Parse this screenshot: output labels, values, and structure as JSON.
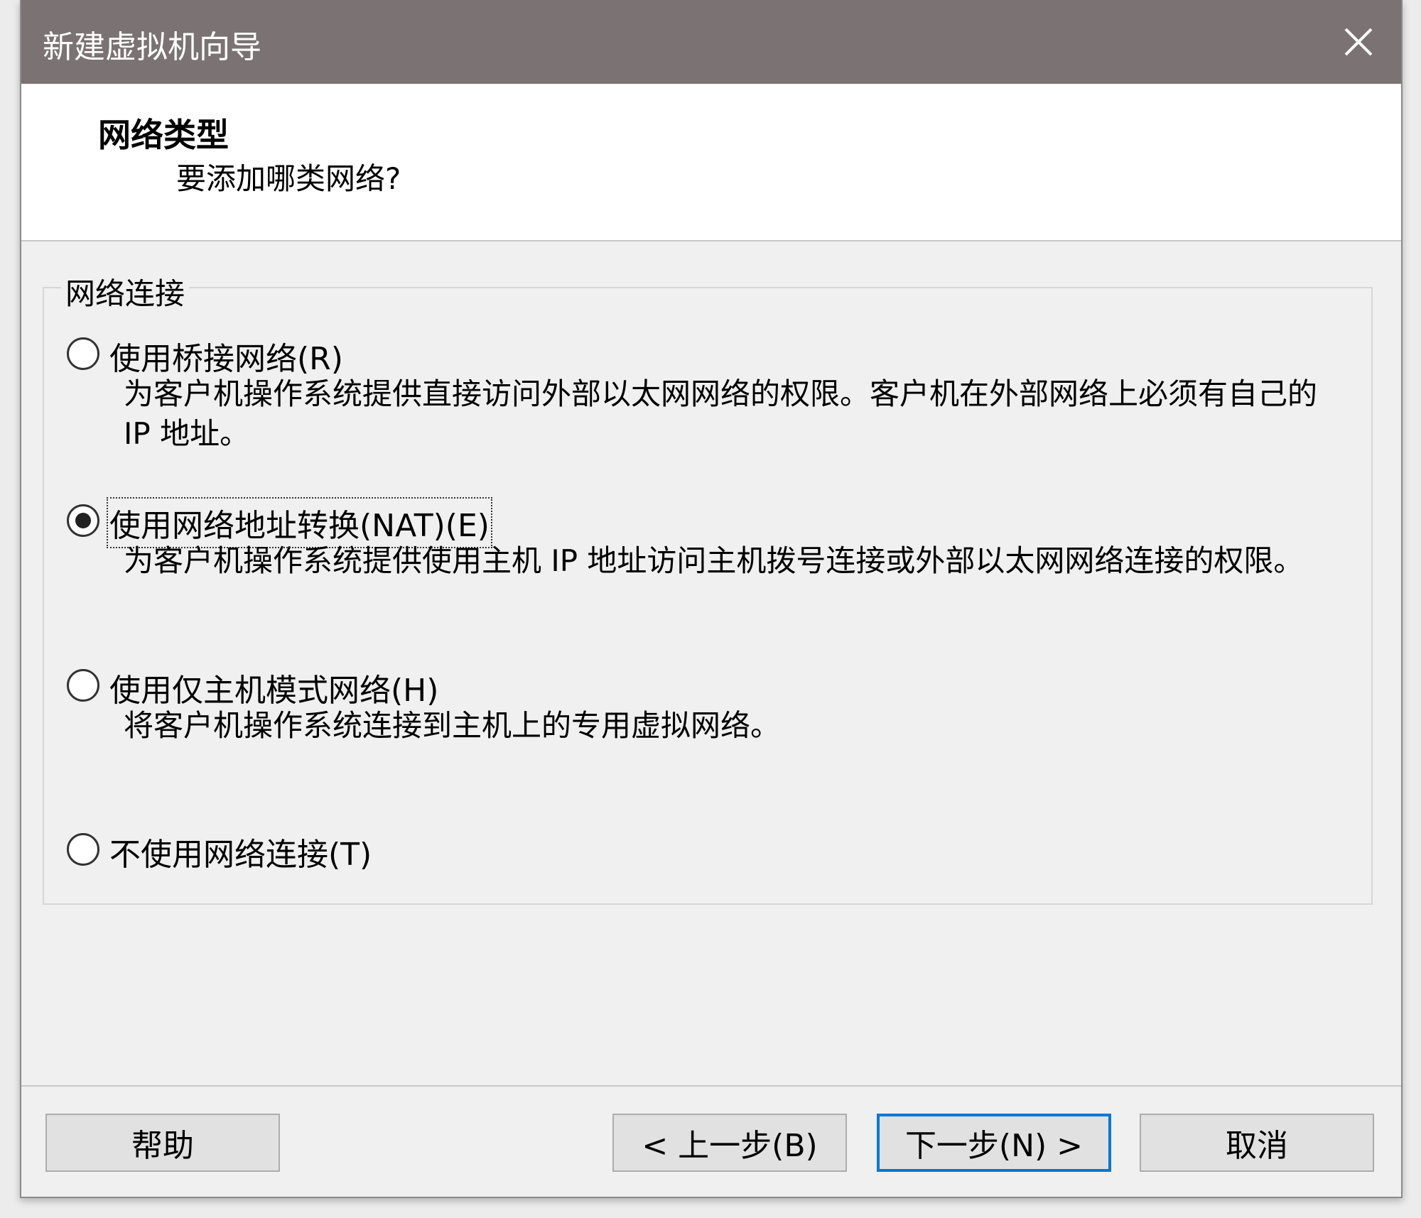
{
  "window": {
    "title": "新建虚拟机向导"
  },
  "header": {
    "title": "网络类型",
    "subtitle": "要添加哪类网络?"
  },
  "group": {
    "legend": "网络连接",
    "options": [
      {
        "label": "使用桥接网络(R)",
        "description": "为客户机操作系统提供直接访问外部以太网网络的权限。客户机在外部网络上必须有自己的 IP 地址。",
        "checked": false
      },
      {
        "label": "使用网络地址转换(NAT)(E)",
        "description": "为客户机操作系统提供使用主机 IP 地址访问主机拨号连接或外部以太网网络连接的权限。",
        "checked": true
      },
      {
        "label": "使用仅主机模式网络(H)",
        "description": "将客户机操作系统连接到主机上的专用虚拟网络。",
        "checked": false
      },
      {
        "label": "不使用网络连接(T)",
        "checked": false
      }
    ]
  },
  "buttons": {
    "help": "帮助",
    "back": "< 上一步(B)",
    "next": "下一步(N) >",
    "cancel": "取消"
  }
}
